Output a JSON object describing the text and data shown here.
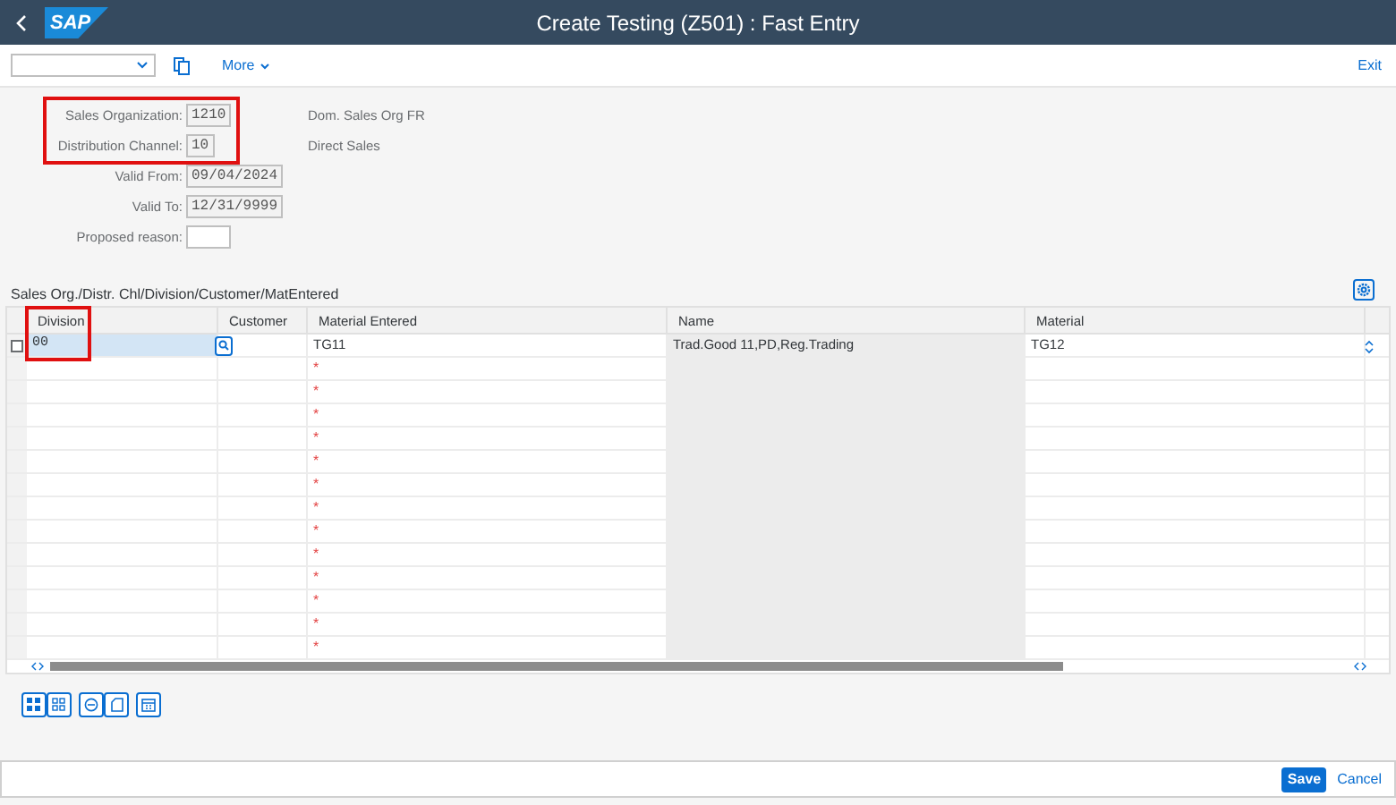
{
  "header": {
    "logo": "SAP",
    "title": "Create Testing (Z501) : Fast Entry"
  },
  "toolbar": {
    "more": "More",
    "exit": "Exit"
  },
  "form": {
    "fields": [
      {
        "label": "Sales Organization:",
        "value": "1210",
        "description": "Dom. Sales Org FR",
        "highlighted": true
      },
      {
        "label": "Distribution Channel:",
        "value": "10",
        "description": "Direct Sales",
        "highlighted": true
      },
      {
        "label": "Valid From:",
        "value": "09/04/2024",
        "highlighted": false
      },
      {
        "label": "Valid To:",
        "value": "12/31/9999",
        "highlighted": false
      },
      {
        "label": "Proposed reason:",
        "highlighted": false
      }
    ]
  },
  "table": {
    "title": "Sales Org./Distr. Chl/Division/Customer/MatEntered",
    "columns": [
      {
        "label": "Division",
        "highlighted": true
      },
      {
        "label": "Customer",
        "highlighted": false
      },
      {
        "label": "Material Entered",
        "highlighted": false
      },
      {
        "label": "Name",
        "highlighted": false
      },
      {
        "label": "Material",
        "highlighted": false
      }
    ],
    "rows": [
      {
        "cells": [
          "00",
          "",
          "TG11",
          "Trad.Good 11,PD,Reg.Trading",
          "TG12"
        ],
        "checked": false
      },
      {
        "required": "*"
      },
      {
        "required": "*"
      },
      {
        "required": "*"
      },
      {
        "required": "*"
      },
      {
        "required": "*"
      },
      {
        "required": "*"
      },
      {
        "required": "*"
      },
      {
        "required": "*"
      },
      {
        "required": "*"
      },
      {
        "required": "*"
      },
      {
        "required": "*"
      },
      {
        "required": "*"
      },
      {
        "required": "*"
      }
    ]
  },
  "footer": {
    "buttons": [
      {
        "label": "Save",
        "kind": "primary"
      },
      {
        "label": "Cancel",
        "kind": "link"
      }
    ]
  }
}
